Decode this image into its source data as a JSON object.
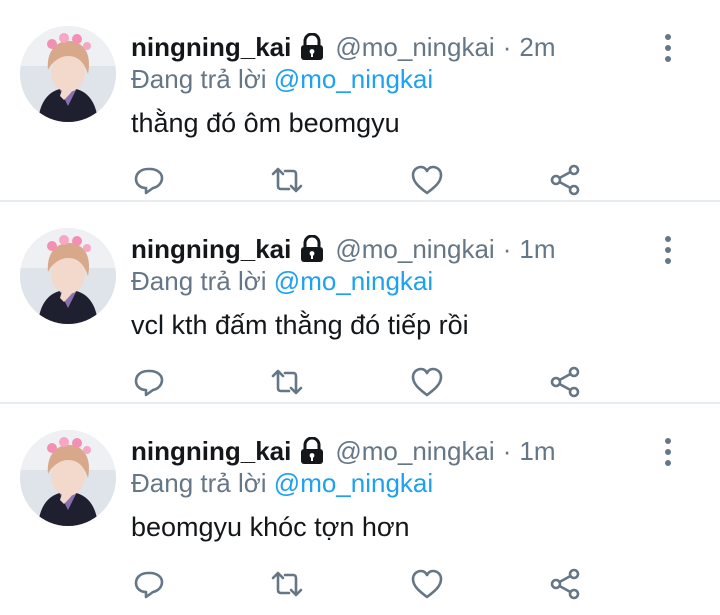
{
  "tweets": [
    {
      "display_name": "ningning_kai",
      "handle": "@mo_ningkai",
      "separator": "·",
      "time": "2m",
      "reply_prefix": "Đang trả lời",
      "reply_to": "@mo_ningkai",
      "text": "thằng đó ôm beomgyu"
    },
    {
      "display_name": "ningning_kai",
      "handle": "@mo_ningkai",
      "separator": "·",
      "time": "1m",
      "reply_prefix": "Đang trả lời",
      "reply_to": "@mo_ningkai",
      "text": "vcl kth đấm thằng đó tiếp rồi"
    },
    {
      "display_name": "ningning_kai",
      "handle": "@mo_ningkai",
      "separator": "·",
      "time": "1m",
      "reply_prefix": "Đang trả lời",
      "reply_to": "@mo_ningkai",
      "text": "beomgyu khóc tợn hơn"
    }
  ],
  "icons": {
    "lock": "lock-icon",
    "more": "more-vertical-icon",
    "reply": "reply-icon",
    "retweet": "retweet-icon",
    "like": "heart-icon",
    "share": "share-icon"
  },
  "colors": {
    "text": "#14171a",
    "secondary": "#657786",
    "link": "#1da1f2",
    "divider": "#e6ecf0"
  }
}
